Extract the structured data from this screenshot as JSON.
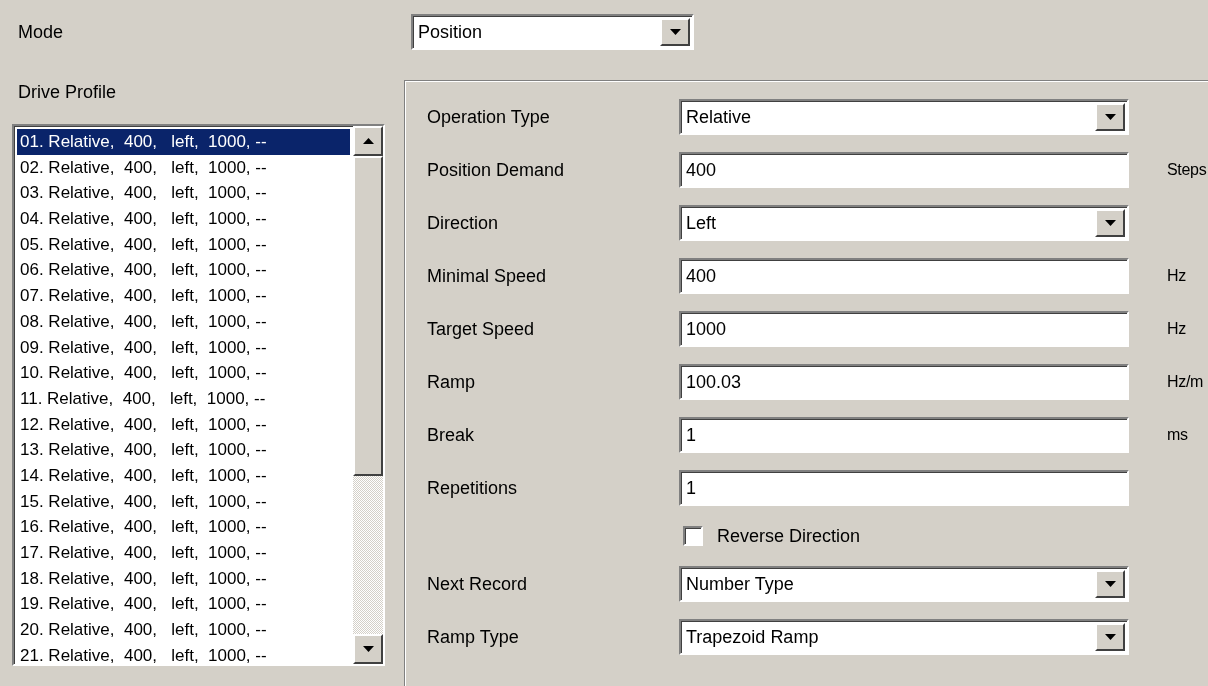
{
  "mode": {
    "label": "Mode",
    "value": "Position"
  },
  "drive_profile": {
    "label": "Drive Profile",
    "items": [
      {
        "text": "01. Relative,  400,   left,  1000, --",
        "selected": true
      },
      {
        "text": "02. Relative,  400,   left,  1000, --",
        "selected": false
      },
      {
        "text": "03. Relative,  400,   left,  1000, --",
        "selected": false
      },
      {
        "text": "04. Relative,  400,   left,  1000, --",
        "selected": false
      },
      {
        "text": "05. Relative,  400,   left,  1000, --",
        "selected": false
      },
      {
        "text": "06. Relative,  400,   left,  1000, --",
        "selected": false
      },
      {
        "text": "07. Relative,  400,   left,  1000, --",
        "selected": false
      },
      {
        "text": "08. Relative,  400,   left,  1000, --",
        "selected": false
      },
      {
        "text": "09. Relative,  400,   left,  1000, --",
        "selected": false
      },
      {
        "text": "10. Relative,  400,   left,  1000, --",
        "selected": false
      },
      {
        "text": "11. Relative,  400,   left,  1000, --",
        "selected": false
      },
      {
        "text": "12. Relative,  400,   left,  1000, --",
        "selected": false
      },
      {
        "text": "13. Relative,  400,   left,  1000, --",
        "selected": false
      },
      {
        "text": "14. Relative,  400,   left,  1000, --",
        "selected": false
      },
      {
        "text": "15. Relative,  400,   left,  1000, --",
        "selected": false
      },
      {
        "text": "16. Relative,  400,   left,  1000, --",
        "selected": false
      },
      {
        "text": "17. Relative,  400,   left,  1000, --",
        "selected": false
      },
      {
        "text": "18. Relative,  400,   left,  1000, --",
        "selected": false
      },
      {
        "text": "19. Relative,  400,   left,  1000, --",
        "selected": false
      },
      {
        "text": "20. Relative,  400,   left,  1000, --",
        "selected": false
      },
      {
        "text": "21. Relative,  400,   left,  1000, --",
        "selected": false
      }
    ]
  },
  "settings": [
    {
      "kind": "dropdown",
      "label": "Operation Type",
      "value": "Relative"
    },
    {
      "kind": "text",
      "label": "Position Demand",
      "value": "400",
      "unit": "Steps"
    },
    {
      "kind": "dropdown",
      "label": "Direction",
      "value": "Left"
    },
    {
      "kind": "text",
      "label": "Minimal Speed",
      "value": "400",
      "unit": "Hz"
    },
    {
      "kind": "text",
      "label": "Target Speed",
      "value": "1000",
      "unit": "Hz"
    },
    {
      "kind": "text",
      "label": "Ramp",
      "value": "100.03",
      "unit": "Hz/m"
    },
    {
      "kind": "text",
      "label": "Break",
      "value": "1",
      "unit": "ms"
    },
    {
      "kind": "text",
      "label": "Repetitions",
      "value": "1"
    },
    {
      "kind": "checkbox",
      "label": "Reverse Direction",
      "checked": false
    },
    {
      "kind": "dropdown",
      "label": "Next Record",
      "value": "Number Type"
    },
    {
      "kind": "dropdown",
      "label": "Ramp Type",
      "value": "Trapezoid Ramp"
    }
  ]
}
